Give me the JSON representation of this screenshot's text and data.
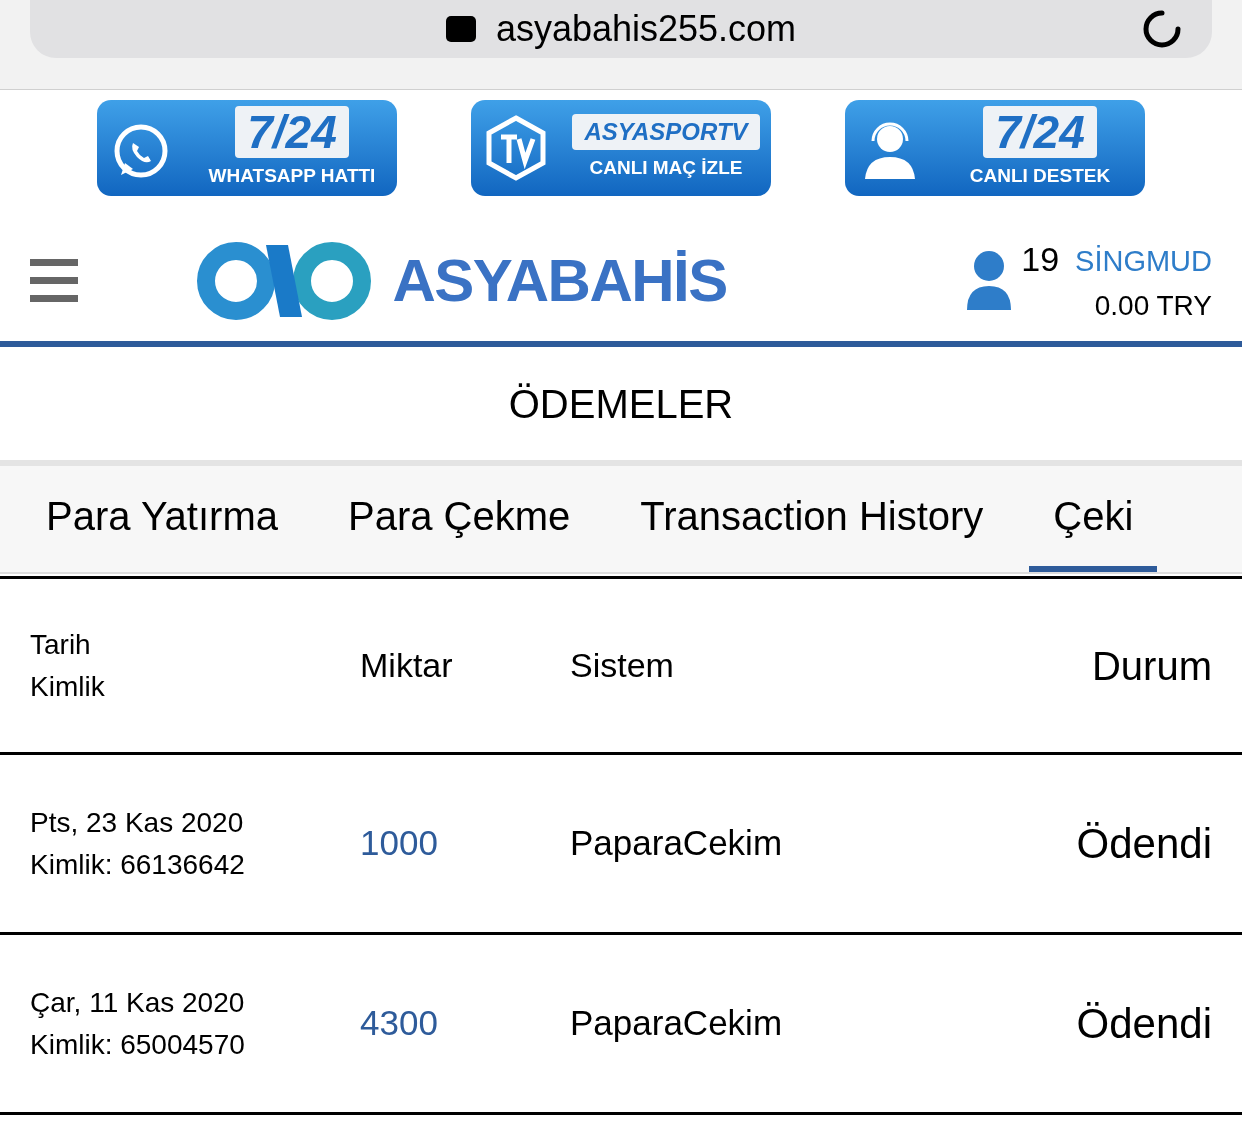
{
  "browser": {
    "url": "asyabahis255.com"
  },
  "banners": [
    {
      "kind": "whatsapp",
      "title": "7/24",
      "subtitle": "WHATSAPP HATTI"
    },
    {
      "kind": "tv",
      "title": "ASYASPORTV",
      "subtitle": "CANLI MAÇ İZLE"
    },
    {
      "kind": "support",
      "title": "7/24",
      "subtitle": "CANLI DESTEK"
    }
  ],
  "header": {
    "logo": "ASYABAHİS",
    "user_count": "19",
    "username": "SİNGMUD",
    "balance": "0.00 TRY"
  },
  "page_title": "ÖDEMELER",
  "tabs": [
    {
      "label": "Para Yatırma",
      "selected": false
    },
    {
      "label": "Para Çekme",
      "selected": false
    },
    {
      "label": "Transaction History",
      "selected": false
    },
    {
      "label": "Çeki",
      "selected": true
    }
  ],
  "table": {
    "columns": [
      {
        "line1": "Tarih",
        "line2": "Kimlik"
      },
      "Miktar",
      "Sistem",
      "Durum"
    ],
    "rows": [
      {
        "date": "Pts, 23 Kas 2020",
        "id": "Kimlik: 66136642",
        "amount": "1000",
        "system": "PaparaCekim",
        "status": "Ödendi"
      },
      {
        "date": "Çar, 11 Kas 2020",
        "id": "Kimlik: 65004570",
        "amount": "4300",
        "system": "PaparaCekim",
        "status": "Ödendi"
      }
    ]
  }
}
